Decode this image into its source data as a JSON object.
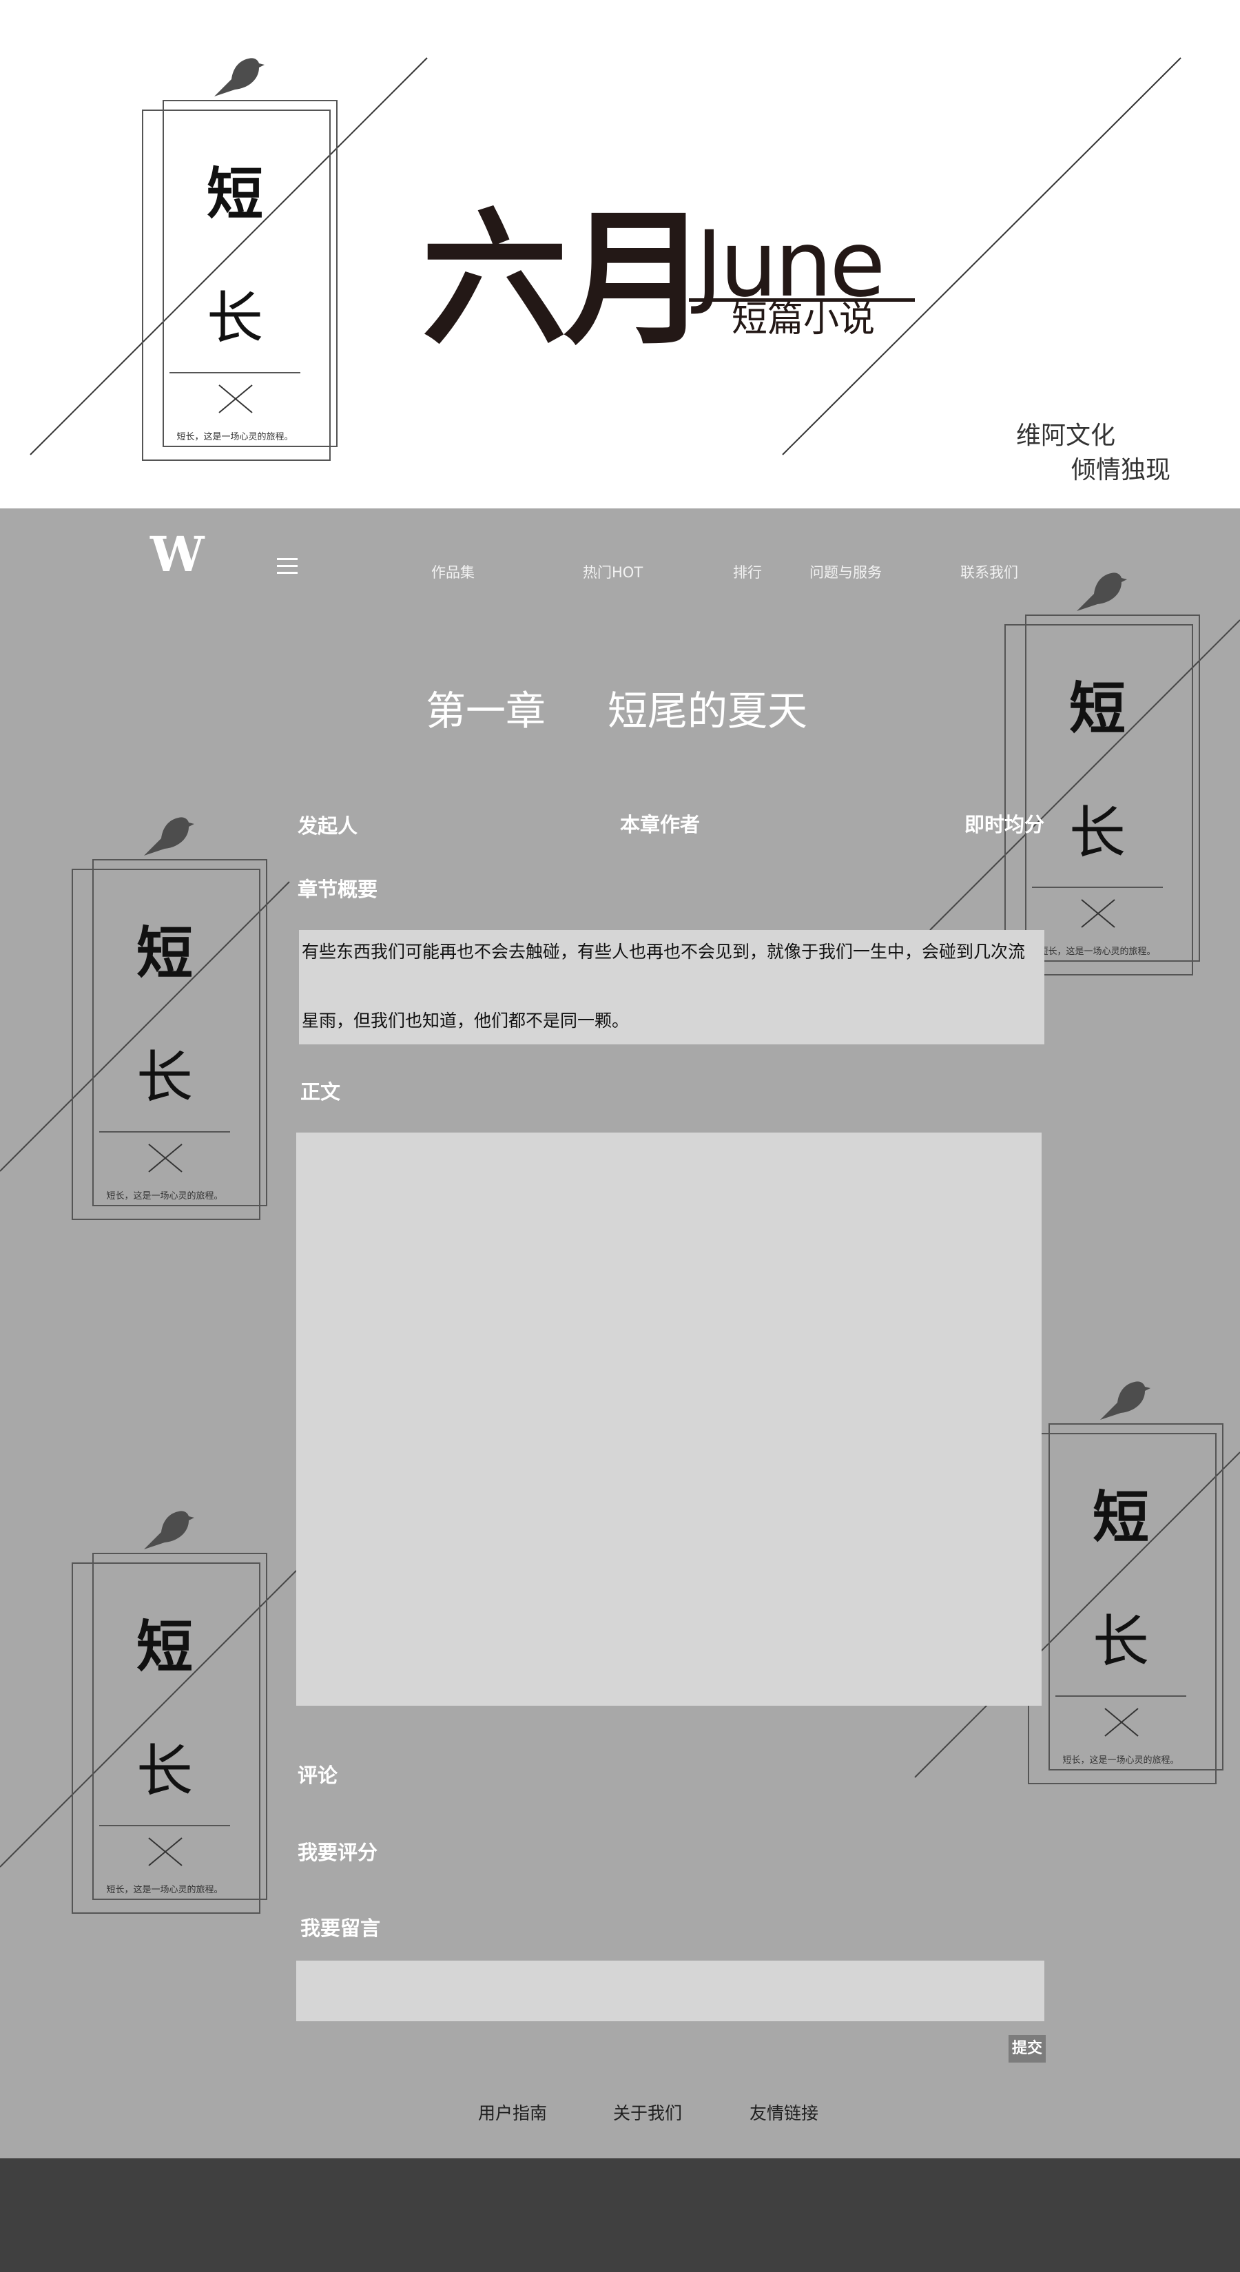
{
  "hero": {
    "title_big": "六月",
    "title_latin": "June",
    "subtitle": "短篇小说",
    "slogan_line1": "维阿文化",
    "slogan_line2": "倾情独现"
  },
  "bookmark": {
    "char_top": "短",
    "char_bottom": "长",
    "caption": "短长，这是一场心灵的旅程。"
  },
  "nav": {
    "logo": "W",
    "menu_icon": "hamburger-icon",
    "items": [
      {
        "label": "作品集"
      },
      {
        "label": "热门HOT"
      },
      {
        "label": "排行"
      },
      {
        "label": "问题与服务"
      },
      {
        "label": "联系我们"
      }
    ]
  },
  "chapter": {
    "number": "第一章",
    "title": "短尾的夏天",
    "initiator_label": "发起人",
    "author_label": "本章作者",
    "score_label": "即时均分",
    "summary_label": "章节概要",
    "summary_text": "有些东西我们可能再也不会去触碰，有些人也再也不会见到，就像于我们一生中，会碰到几次流星雨，但我们也知道，他们都不是同一颗。",
    "body_label": "正文",
    "body_text": ""
  },
  "comments": {
    "comments_label": "评论",
    "rate_label": "我要评分",
    "message_label": "我要留言",
    "message_value": "",
    "submit_label": "提交"
  },
  "footer": {
    "links": [
      {
        "label": "用户指南"
      },
      {
        "label": "关于我们"
      },
      {
        "label": "友情链接"
      }
    ]
  },
  "colors": {
    "main_bg": "#a8a8a8",
    "panel_bg": "#d6d6d6",
    "footer_bg": "#404040",
    "title_dark": "#231816"
  }
}
